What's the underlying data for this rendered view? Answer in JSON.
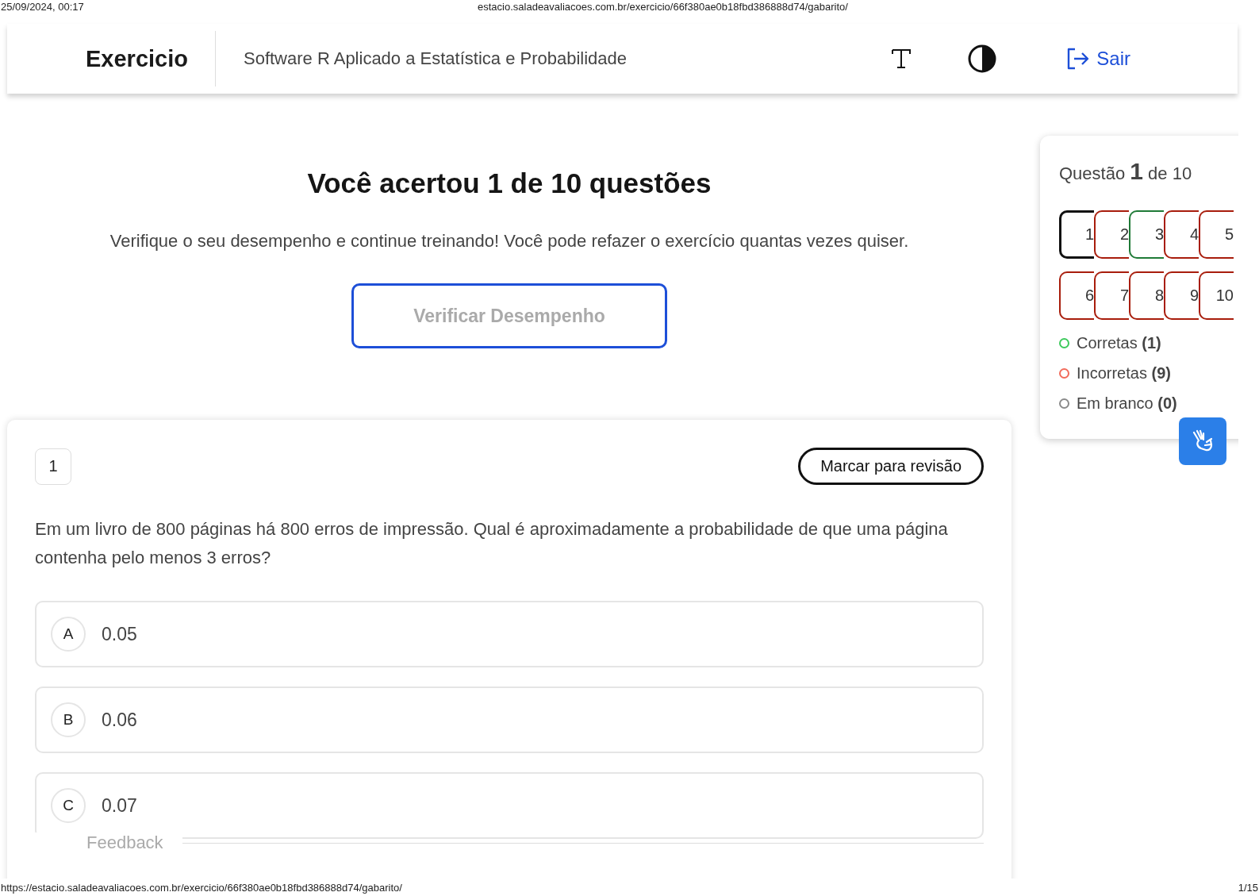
{
  "print_header": {
    "date": "25/09/2024, 00:17",
    "url": "estacio.saladeavaliacoes.com.br/exercicio/66f380ae0b18fbd386888d74/gabarito/"
  },
  "header": {
    "title": "Exercicio",
    "subject": "Software R Aplicado a Estatística e Probabilidade",
    "logout": "Sair"
  },
  "result": {
    "title": "Você acertou 1 de 10 questões",
    "subtitle": "Verifique o seu desempenho e continue treinando! Você pode refazer o exercício quantas vezes quiser.",
    "button": "Verificar Desempenho"
  },
  "question": {
    "number": "1",
    "review_button": "Marcar para revisão",
    "text": "Em um livro de 800 páginas há 800 erros de impressão. Qual é aproximadamente a probabilidade de que uma página contenha pelo menos 3 erros?",
    "options": [
      {
        "letter": "A",
        "value": "0.05"
      },
      {
        "letter": "B",
        "value": "0.06"
      },
      {
        "letter": "C",
        "value": "0.07"
      }
    ],
    "feedback": "Feedback"
  },
  "sidebar": {
    "heading_prefix": "Questão",
    "current": "1",
    "heading_suffix": "de 10",
    "questions": [
      {
        "label": "1",
        "selected": true
      },
      {
        "label": "2",
        "selected": false,
        "color": "#a81d0c"
      },
      {
        "label": "3",
        "selected": false,
        "color": "#1f7a37"
      },
      {
        "label": "4",
        "selected": false,
        "color": "#a81d0c"
      },
      {
        "label": "5",
        "selected": false,
        "color": "#a81d0c"
      },
      {
        "label": "6",
        "selected": false,
        "color": "#a81d0c"
      },
      {
        "label": "7",
        "selected": false,
        "color": "#a81d0c"
      },
      {
        "label": "8",
        "selected": false,
        "color": "#a81d0c"
      },
      {
        "label": "9",
        "selected": false,
        "color": "#a81d0c"
      },
      {
        "label": "10",
        "selected": false,
        "color": "#a81d0c"
      }
    ],
    "legend": [
      {
        "label": "Corretas",
        "count": "(1)",
        "color": "#3ec95c"
      },
      {
        "label": "Incorretas",
        "count": "(9)",
        "color": "#f26b5b"
      },
      {
        "label": "Em branco",
        "count": "(0)",
        "color": "#8a8a8a"
      }
    ]
  },
  "print_footer": {
    "url": "https://estacio.saladeavaliacoes.com.br/exercicio/66f380ae0b18fbd386888d74/gabarito/",
    "page": "1/15"
  }
}
